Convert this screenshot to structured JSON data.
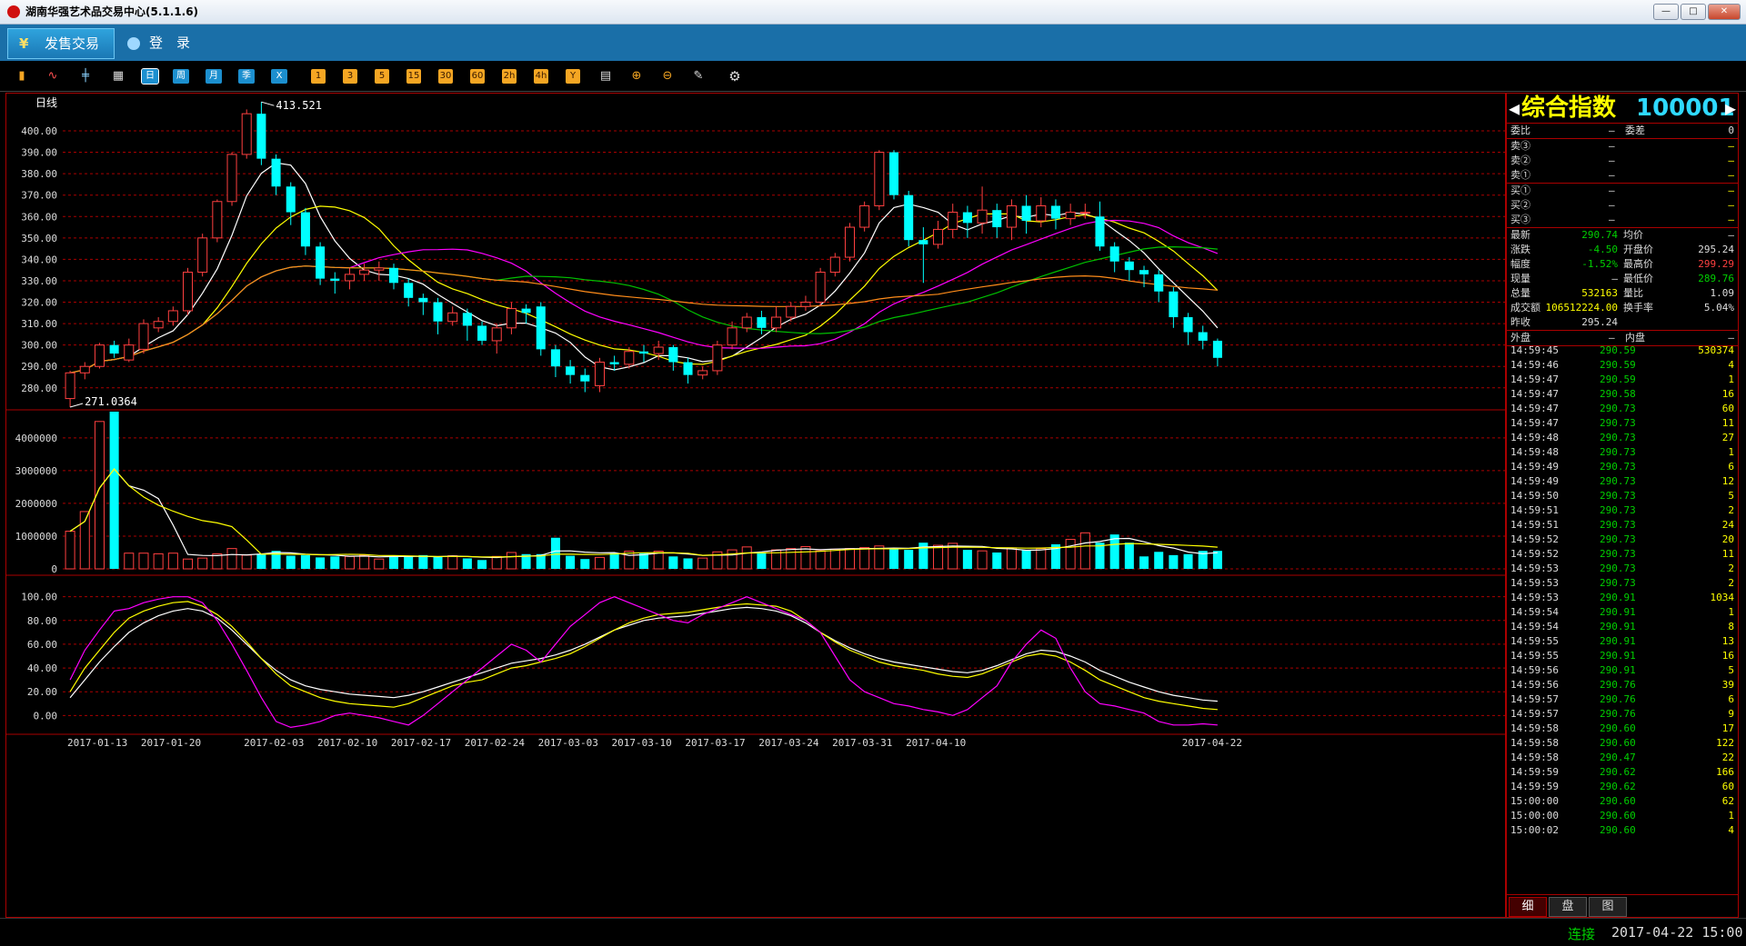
{
  "window": {
    "title": "湖南华强艺术品交易中心(5.1.1.6)",
    "min": "—",
    "max": "□",
    "close": "✕"
  },
  "menubar": {
    "active_tab": "发售交易",
    "active_icon": "¥",
    "login": "登　录"
  },
  "toolbar": {
    "icons": [
      "bar-chart-icon",
      "line-chart-icon",
      "kline-icon",
      "calendar-icon"
    ],
    "periods": [
      "日",
      "周",
      "月",
      "季",
      "X"
    ],
    "minutes": [
      "1",
      "3",
      "5",
      "15",
      "30",
      "60",
      "2h",
      "4h",
      "Y"
    ],
    "tools": [
      "draw-icon",
      "zoom-in-icon",
      "zoom-out-icon",
      "pen-icon",
      "settings-icon"
    ]
  },
  "chart_data": {
    "type": "candlestick",
    "period_label": "日线",
    "high_label": "413.521",
    "low_label": "271.0364",
    "price_ticks": [
      "400.00",
      "390.00",
      "380.00",
      "370.00",
      "360.00",
      "350.00",
      "340.00",
      "330.00",
      "320.00",
      "310.00",
      "300.00",
      "290.00",
      "280.00"
    ],
    "price_range": [
      271,
      414
    ],
    "volume_ticks": [
      "4000000",
      "3000000",
      "2000000",
      "1000000",
      "0"
    ],
    "volume_range": [
      0,
      4800000
    ],
    "kdj_ticks": [
      "100.00",
      "80.00",
      "60.00",
      "40.00",
      "20.00",
      "0.00"
    ],
    "kdj_range": [
      -12,
      112
    ],
    "dates": [
      "2017-01-13",
      "2017-01-20",
      "2017-02-03",
      "2017-02-10",
      "2017-02-17",
      "2017-02-24",
      "2017-03-03",
      "2017-03-10",
      "2017-03-17",
      "2017-03-24",
      "2017-03-31",
      "2017-04-10",
      "2017-04-22"
    ],
    "candles": [
      [
        275,
        287,
        271,
        288
      ],
      [
        287,
        290,
        284,
        292
      ],
      [
        290,
        300,
        289,
        301
      ],
      [
        300,
        296,
        294,
        302
      ],
      [
        293,
        300,
        292,
        303
      ],
      [
        298,
        310,
        296,
        312
      ],
      [
        308,
        311,
        306,
        313
      ],
      [
        311,
        316,
        309,
        318
      ],
      [
        316,
        334,
        314,
        336
      ],
      [
        334,
        350,
        332,
        352
      ],
      [
        350,
        367,
        348,
        368
      ],
      [
        367,
        389,
        365,
        390
      ],
      [
        389,
        408,
        387,
        410
      ],
      [
        408,
        387,
        384,
        413.5
      ],
      [
        387,
        374,
        370,
        389
      ],
      [
        374,
        362,
        356,
        376
      ],
      [
        362,
        346,
        342,
        364
      ],
      [
        346,
        331,
        328,
        348
      ],
      [
        331,
        330,
        324,
        334
      ],
      [
        330,
        333,
        326,
        336
      ],
      [
        333,
        335,
        330,
        338
      ],
      [
        335,
        336,
        330,
        339
      ],
      [
        336,
        329,
        326,
        338
      ],
      [
        329,
        322,
        318,
        331
      ],
      [
        322,
        320,
        314,
        324
      ],
      [
        320,
        311,
        305,
        322
      ],
      [
        311,
        315,
        309,
        318
      ],
      [
        315,
        309,
        302,
        317
      ],
      [
        309,
        302,
        300,
        311
      ],
      [
        302,
        308,
        296,
        310
      ],
      [
        308,
        317,
        305,
        320
      ],
      [
        317,
        315,
        310,
        319
      ],
      [
        318,
        298,
        295,
        320
      ],
      [
        298,
        290,
        285,
        300
      ],
      [
        290,
        286,
        282,
        293
      ],
      [
        286,
        283,
        278,
        289
      ],
      [
        281,
        292,
        278,
        294
      ],
      [
        292,
        291,
        288,
        295
      ],
      [
        291,
        297,
        289,
        299
      ],
      [
        297,
        296,
        292,
        300
      ],
      [
        296,
        299,
        293,
        302
      ],
      [
        299,
        292,
        288,
        300
      ],
      [
        292,
        286,
        282,
        294
      ],
      [
        286,
        288,
        284,
        290
      ],
      [
        288,
        300,
        286,
        302
      ],
      [
        300,
        308,
        298,
        311
      ],
      [
        308,
        313,
        306,
        315
      ],
      [
        313,
        308,
        305,
        316
      ],
      [
        308,
        313,
        306,
        318
      ],
      [
        313,
        318,
        311,
        320
      ],
      [
        318,
        320,
        316,
        323
      ],
      [
        320,
        334,
        318,
        336
      ],
      [
        334,
        341,
        332,
        343
      ],
      [
        341,
        355,
        339,
        357
      ],
      [
        355,
        365,
        353,
        367
      ],
      [
        365,
        390,
        363,
        391
      ],
      [
        390,
        370,
        368,
        391
      ],
      [
        370,
        349,
        346,
        372
      ],
      [
        349,
        347,
        329,
        355
      ],
      [
        347,
        354,
        345,
        358
      ],
      [
        354,
        362,
        350,
        366
      ],
      [
        362,
        357,
        350,
        365
      ],
      [
        357,
        363,
        352,
        374
      ],
      [
        363,
        355,
        350,
        366
      ],
      [
        355,
        365,
        349,
        368
      ],
      [
        365,
        358,
        352,
        370
      ],
      [
        358,
        365,
        355,
        369
      ],
      [
        365,
        359,
        354,
        368
      ],
      [
        359,
        362,
        356,
        366
      ],
      [
        362,
        362,
        359,
        366
      ],
      [
        360,
        346,
        344,
        367
      ],
      [
        346,
        339,
        334,
        348
      ],
      [
        339,
        335,
        330,
        341
      ],
      [
        335,
        333,
        327,
        337
      ],
      [
        333,
        325,
        320,
        335
      ],
      [
        325,
        313,
        308,
        327
      ],
      [
        313,
        306,
        300,
        315
      ],
      [
        306,
        302,
        298,
        309
      ],
      [
        302,
        294,
        290,
        303
      ]
    ],
    "volumes": [
      1.15,
      1.75,
      4.5,
      4.8,
      0.48,
      0.48,
      0.46,
      0.48,
      0.3,
      0.33,
      0.46,
      0.62,
      0.42,
      0.45,
      0.55,
      0.4,
      0.42,
      0.35,
      0.38,
      0.38,
      0.42,
      0.3,
      0.4,
      0.38,
      0.42,
      0.36,
      0.4,
      0.32,
      0.27,
      0.38,
      0.5,
      0.45,
      0.45,
      0.95,
      0.4,
      0.3,
      0.35,
      0.48,
      0.54,
      0.5,
      0.54,
      0.38,
      0.32,
      0.33,
      0.52,
      0.58,
      0.67,
      0.5,
      0.58,
      0.62,
      0.68,
      0.55,
      0.6,
      0.62,
      0.65,
      0.7,
      0.6,
      0.58,
      0.8,
      0.72,
      0.78,
      0.58,
      0.55,
      0.5,
      0.64,
      0.58,
      0.62,
      0.75,
      0.9,
      1.1,
      0.8,
      1.05,
      0.8,
      0.38,
      0.52,
      0.42,
      0.45,
      0.55,
      0.55
    ],
    "kdj_k": [
      30,
      55,
      72,
      88,
      90,
      95,
      98,
      100,
      100,
      95,
      80,
      60,
      38,
      15,
      -5,
      -10,
      -8,
      -5,
      0,
      2,
      0,
      -2,
      -5,
      -8,
      0,
      10,
      20,
      30,
      40,
      50,
      60,
      55,
      45,
      60,
      75,
      85,
      95,
      100,
      95,
      90,
      85,
      80,
      78,
      85,
      90,
      95,
      100,
      95,
      90,
      85,
      80,
      70,
      50,
      30,
      20,
      15,
      10,
      8,
      5,
      3,
      0,
      5,
      15,
      25,
      45,
      60,
      72,
      65,
      40,
      20,
      10,
      8,
      5,
      2,
      -5,
      -8,
      -8,
      -7,
      -8
    ],
    "kdj_d": [
      20,
      40,
      55,
      70,
      82,
      88,
      92,
      95,
      96,
      92,
      85,
      75,
      62,
      48,
      35,
      25,
      20,
      15,
      12,
      10,
      9,
      8,
      7,
      10,
      15,
      20,
      25,
      28,
      30,
      35,
      40,
      42,
      45,
      48,
      52,
      58,
      65,
      72,
      78,
      82,
      85,
      86,
      87,
      89,
      91,
      93,
      94,
      93,
      92,
      88,
      80,
      70,
      62,
      55,
      50,
      45,
      42,
      40,
      38,
      35,
      33,
      32,
      35,
      40,
      45,
      50,
      52,
      50,
      45,
      38,
      30,
      25,
      20,
      15,
      12,
      10,
      8,
      6,
      5
    ],
    "kdj_j": [
      15,
      30,
      45,
      58,
      70,
      78,
      84,
      88,
      90,
      88,
      82,
      72,
      60,
      48,
      38,
      30,
      25,
      22,
      20,
      18,
      17,
      16,
      15,
      17,
      20,
      24,
      28,
      32,
      36,
      40,
      44,
      46,
      48,
      51,
      55,
      60,
      66,
      72,
      76,
      80,
      82,
      83,
      84,
      86,
      88,
      90,
      91,
      90,
      88,
      84,
      78,
      70,
      63,
      57,
      52,
      48,
      45,
      43,
      41,
      39,
      37,
      36,
      38,
      42,
      47,
      52,
      55,
      54,
      50,
      45,
      38,
      33,
      28,
      24,
      20,
      17,
      15,
      13,
      12
    ]
  },
  "side": {
    "name": "综合指数",
    "code": "100001",
    "ratio_label": "委比",
    "ratio_val": "—",
    "diff_label": "委差",
    "diff_val": "0",
    "asks": [
      {
        "label": "卖③",
        "price": "—",
        "vol": "—"
      },
      {
        "label": "卖②",
        "price": "—",
        "vol": "—"
      },
      {
        "label": "卖①",
        "price": "—",
        "vol": "—"
      }
    ],
    "bids": [
      {
        "label": "买①",
        "price": "—",
        "vol": "—"
      },
      {
        "label": "买②",
        "price": "—",
        "vol": "—"
      },
      {
        "label": "买③",
        "price": "—",
        "vol": "—"
      }
    ],
    "stats": [
      {
        "l1": "最新",
        "v1": "290.74",
        "l2": "均价",
        "v2": "—",
        "c1": "#00d000",
        "c2": "#ddd"
      },
      {
        "l1": "涨跌",
        "v1": "-4.50",
        "l2": "开盘价",
        "v2": "295.24",
        "c1": "#00d000",
        "c2": "#ddd"
      },
      {
        "l1": "幅度",
        "v1": "-1.52%",
        "l2": "最高价",
        "v2": "299.29",
        "c1": "#00d000",
        "c2": "#ff4040"
      },
      {
        "l1": "现量",
        "v1": "—",
        "l2": "最低价",
        "v2": "289.76",
        "c1": "#ddd",
        "c2": "#00d000"
      },
      {
        "l1": "总量",
        "v1": "532163",
        "l2": "量比",
        "v2": "1.09",
        "c1": "#ffff00",
        "c2": "#ddd"
      },
      {
        "l1": "成交额",
        "v1": "106512224.00",
        "l2": "换手率",
        "v2": "5.04%",
        "c1": "#ffff00",
        "c2": "#ddd"
      },
      {
        "l1": "昨收",
        "v1": "295.24",
        "l2": "",
        "v2": "",
        "c1": "#ddd",
        "c2": "#ddd"
      }
    ],
    "outer_label": "外盘",
    "outer_val": "—",
    "inner_label": "内盘",
    "inner_val": "—",
    "trades": [
      [
        "14:59:45",
        "290.59",
        "530374"
      ],
      [
        "14:59:46",
        "290.59",
        "4"
      ],
      [
        "14:59:47",
        "290.59",
        "1"
      ],
      [
        "14:59:47",
        "290.58",
        "16"
      ],
      [
        "14:59:47",
        "290.73",
        "60"
      ],
      [
        "14:59:47",
        "290.73",
        "11"
      ],
      [
        "14:59:48",
        "290.73",
        "27"
      ],
      [
        "14:59:48",
        "290.73",
        "1"
      ],
      [
        "14:59:49",
        "290.73",
        "6"
      ],
      [
        "14:59:49",
        "290.73",
        "12"
      ],
      [
        "14:59:50",
        "290.73",
        "5"
      ],
      [
        "14:59:51",
        "290.73",
        "2"
      ],
      [
        "14:59:51",
        "290.73",
        "24"
      ],
      [
        "14:59:52",
        "290.73",
        "20"
      ],
      [
        "14:59:52",
        "290.73",
        "11"
      ],
      [
        "14:59:53",
        "290.73",
        "2"
      ],
      [
        "14:59:53",
        "290.73",
        "2"
      ],
      [
        "14:59:53",
        "290.91",
        "1034"
      ],
      [
        "14:59:54",
        "290.91",
        "1"
      ],
      [
        "14:59:54",
        "290.91",
        "8"
      ],
      [
        "14:59:55",
        "290.91",
        "13"
      ],
      [
        "14:59:55",
        "290.91",
        "16"
      ],
      [
        "14:59:56",
        "290.91",
        "5"
      ],
      [
        "14:59:56",
        "290.76",
        "39"
      ],
      [
        "14:59:57",
        "290.76",
        "6"
      ],
      [
        "14:59:57",
        "290.76",
        "9"
      ],
      [
        "14:59:58",
        "290.60",
        "17"
      ],
      [
        "14:59:58",
        "290.60",
        "122"
      ],
      [
        "14:59:58",
        "290.47",
        "22"
      ],
      [
        "14:59:59",
        "290.62",
        "166"
      ],
      [
        "14:59:59",
        "290.62",
        "60"
      ],
      [
        "15:00:00",
        "290.60",
        "62"
      ],
      [
        "15:00:00",
        "290.60",
        "1"
      ],
      [
        "15:00:02",
        "290.60",
        "4"
      ]
    ],
    "tabs": [
      "细",
      "盘",
      "图"
    ]
  },
  "status": {
    "conn": "连接",
    "time": "2017-04-22 15:00"
  }
}
